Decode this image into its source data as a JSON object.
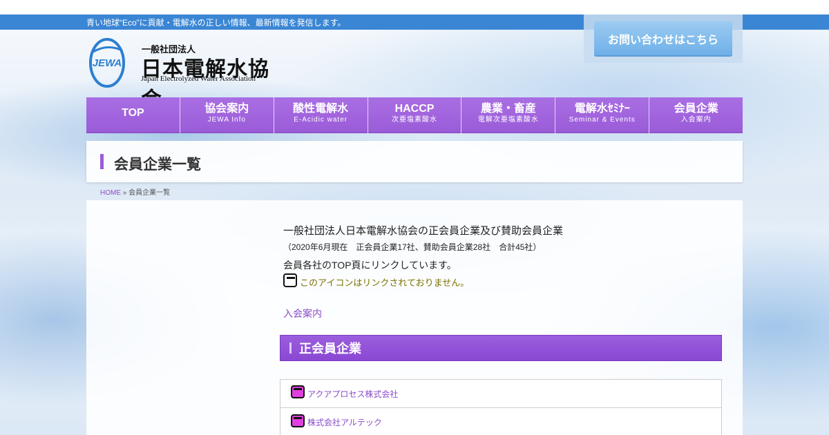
{
  "header": {
    "tagline": "青い地球“Eco”に貢献・電解水の正しい情報、最新情報を発信します。",
    "contact_button": "お問い合わせはこちら",
    "logo": {
      "mark_text": "JEWA",
      "sub": "一般社団法人",
      "main": "日本電解水協会",
      "english": "Japan Electrolyzed Water Association"
    }
  },
  "nav": {
    "items": [
      {
        "label": "TOP",
        "sub": ""
      },
      {
        "label": "協会案内",
        "sub": "JEWA Info"
      },
      {
        "label": "酸性電解水",
        "sub": "E-Acidic water"
      },
      {
        "label": "HACCP",
        "sub": "次亜塩素酸水"
      },
      {
        "label": "農業・畜産",
        "sub": "電解次亜塩素酸水"
      },
      {
        "label": "電解水ｾﾐﾅｰ",
        "sub": "Seminar & Events"
      },
      {
        "label": "会員企業",
        "sub": "入会案内"
      }
    ]
  },
  "page": {
    "title": "会員企業一覧",
    "breadcrumb": {
      "home": "HOME",
      "separator": "»",
      "current": "会員企業一覧"
    }
  },
  "content": {
    "intro": "一般社団法人日本電解水協会の正会員企業及び賛助会員企業",
    "counts": "（2020年6月現在　正会員企業17社、賛助会員企業28社　合計45社）",
    "link_note": "会員各社のTOP頁にリンクしています。",
    "icon_note": "このアイコンはリンクされておりません。",
    "join_link": "入会案内",
    "section_title": "正会員企業",
    "members": [
      "アクアプロセス株式会社",
      "株式会社アルテック"
    ]
  },
  "colors": {
    "accent": "#9a5bd8",
    "topbar": "#3a86d4",
    "link": "#8a4bc9",
    "note": "#7a7000"
  }
}
